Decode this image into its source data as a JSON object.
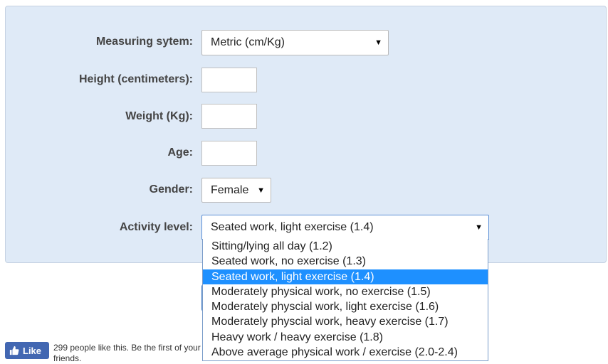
{
  "form": {
    "measuring_system": {
      "label": "Measuring sytem:",
      "value": "Metric (cm/Kg)"
    },
    "height": {
      "label": "Height (centimeters):",
      "value": ""
    },
    "weight": {
      "label": "Weight (Kg):",
      "value": ""
    },
    "age": {
      "label": "Age:",
      "value": ""
    },
    "gender": {
      "label": "Gender:",
      "value": "Female"
    },
    "activity": {
      "label": "Activity level:",
      "value": "Seated work, light exercise (1.4)",
      "options": [
        "Sitting/lying all day (1.2)",
        "Seated work, no exercise (1.3)",
        "Seated work, light exercise (1.4)",
        "Moderately physical work, no exercise (1.5)",
        "Moderately physcial work, light exercise (1.6)",
        "Moderately physcial work, heavy exercise (1.7)",
        "Heavy work / heavy exercise (1.8)",
        "Above average physical work / exercise (2.0-2.4)"
      ],
      "selected_index": 2
    }
  },
  "facebook": {
    "like_label": "Like",
    "text": "299 people like this. Be the first of your friends."
  },
  "colors": {
    "panel_bg": "#dfeaf7",
    "selected_option": "#1e90ff",
    "facebook_blue": "#4267b2"
  }
}
